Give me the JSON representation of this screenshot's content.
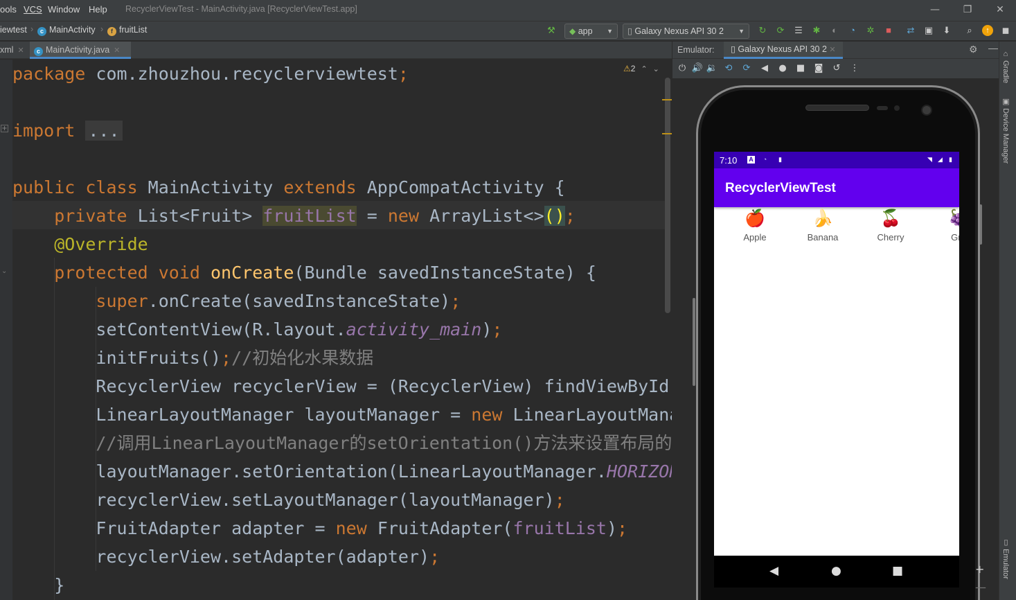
{
  "window": {
    "title": "RecyclerViewTest - MainActivity.java [RecyclerViewTest.app]",
    "menu": [
      "ools",
      "VCS",
      "Window",
      "Help"
    ],
    "controls": {
      "minimize": "—",
      "maximize": "❐",
      "close": "✕"
    }
  },
  "breadcrumb": [
    {
      "label": "iewtest",
      "icon": "none"
    },
    {
      "label": "MainActivity",
      "icon": "class-icon"
    },
    {
      "label": "fruitList",
      "icon": "field-icon"
    }
  ],
  "toolbar": {
    "build_icon": "hammer-icon",
    "run_config": "app",
    "device": "Galaxy Nexus API 30 2"
  },
  "editor_tabs": [
    {
      "label": "xml",
      "active": false
    },
    {
      "label": "MainActivity.java",
      "active": true
    }
  ],
  "inspection": {
    "warnings": "2"
  },
  "code": {
    "l1_kw": "package",
    "l1_rest": " com.zhouzhou.recyclerviewtest",
    "l1_semi": ";",
    "l3_kw": "import",
    "l3_fold": "...",
    "l5_kw1": "public class",
    "l5_name": " MainActivity ",
    "l5_kw2": "extends",
    "l5_rest": " AppCompatActivity {",
    "l6_kw": "private",
    "l6_type": " List<Fruit> ",
    "l6_field": "fruitList",
    "l6_eq": " = ",
    "l6_new": "new",
    "l6_rest": " ArrayList<>",
    "l6_paren": "()",
    "l6_semi": ";",
    "l7_ann": "@Override",
    "l8_kw1": "protected",
    "l8_kw2": " void ",
    "l8_fn": "onCreate",
    "l8_rest": "(Bundle savedInstanceState) {",
    "l9_kw": "super",
    "l9_rest": ".onCreate(savedInstanceState)",
    "l9_semi": ";",
    "l10_a": "setContentView(R.layout.",
    "l10_it": "activity_main",
    "l10_b": ")",
    "l10_semi": ";",
    "l11_a": "initFruits()",
    "l11_semi": ";",
    "l11_cm": "//初始化水果数据",
    "l12": "RecyclerView recyclerView = (RecyclerView) findViewById(",
    "l13_a": "LinearLayoutManager layoutManager = ",
    "l13_new": "new",
    "l13_b": " LinearLayoutMana",
    "l14_cm": "//调用LinearLayoutManager的setOrientation()方法来设置布局的",
    "l15_a": "layoutManager.setOrientation(LinearLayoutManager.",
    "l15_it": "HORIZON",
    "l16_a": "recyclerView.setLayoutManager(layoutManager)",
    "l16_semi": ";",
    "l17_a": "FruitAdapter adapter = ",
    "l17_new": "new",
    "l17_b": " FruitAdapter(",
    "l17_fd": "fruitList",
    "l17_c": ")",
    "l17_semi": ";",
    "l18_a": "recyclerView.setAdapter(adapter)",
    "l18_semi": ";",
    "l19": "}"
  },
  "emulator": {
    "label": "Emulator:",
    "device_tab": "Galaxy Nexus API 30 2",
    "status_time": "7:10",
    "app_title": "RecyclerViewTest",
    "fruits": [
      {
        "name": "Apple",
        "icon": "🍎"
      },
      {
        "name": "Banana",
        "icon": "🍌"
      },
      {
        "name": "Cherry",
        "icon": "🍒"
      },
      {
        "name": "Gra",
        "icon": "🍇"
      }
    ],
    "nav": {
      "back": "◀",
      "home": "●",
      "recents": "■"
    }
  },
  "side_tools": {
    "gradle": "Gradle",
    "device_manager": "Device Manager",
    "emulator": "Emulator"
  },
  "colors": {
    "accent": "#4a88c7",
    "app_bar": "#6200ee",
    "status_bar": "#3700b3"
  }
}
